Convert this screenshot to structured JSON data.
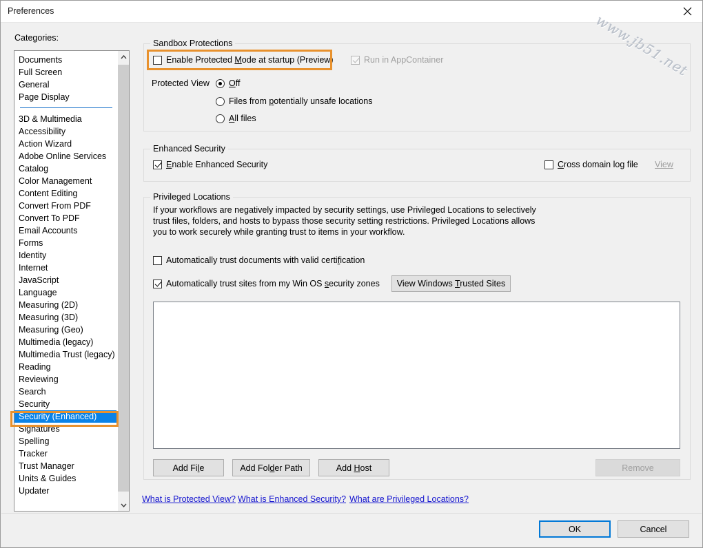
{
  "window": {
    "title": "Preferences",
    "close_icon": "close-icon",
    "watermark": "www.jb51.net"
  },
  "categories": {
    "label": "Categories:",
    "group1": [
      "Documents",
      "Full Screen",
      "General",
      "Page Display"
    ],
    "group2": [
      "3D & Multimedia",
      "Accessibility",
      "Action Wizard",
      "Adobe Online Services",
      "Catalog",
      "Color Management",
      "Content Editing",
      "Convert From PDF",
      "Convert To PDF",
      "Email Accounts",
      "Forms",
      "Identity",
      "Internet",
      "JavaScript",
      "Language",
      "Measuring (2D)",
      "Measuring (3D)",
      "Measuring (Geo)",
      "Multimedia (legacy)",
      "Multimedia Trust (legacy)",
      "Reading",
      "Reviewing",
      "Search",
      "Security",
      "Security (Enhanced)",
      "Signatures",
      "Spelling",
      "Tracker",
      "Trust Manager",
      "Units & Guides",
      "Updater"
    ],
    "selected": "Security (Enhanced)",
    "scroll_up_icon": "chevron-up-icon",
    "scroll_down_icon": "chevron-down-icon"
  },
  "sandbox": {
    "title": "Sandbox Protections",
    "enable_protected_mode": {
      "text_before": "Enable Protected ",
      "accel": "M",
      "text_after": "ode at startup (Preview)",
      "checked": false
    },
    "run_in_appcontainer": {
      "text_before": "Run in AppContainer",
      "checked": true,
      "disabled": true
    },
    "protected_view_label": "Protected View",
    "radios": [
      {
        "before": "",
        "accel": "O",
        "after": "ff",
        "checked": true
      },
      {
        "before": "Files from ",
        "accel": "p",
        "after": "otentially unsafe locations",
        "checked": false
      },
      {
        "before": "",
        "accel": "A",
        "after": "ll files",
        "checked": false
      }
    ]
  },
  "enhanced": {
    "title": "Enhanced Security",
    "enable": {
      "before": "",
      "accel": "E",
      "after": "nable Enhanced Security",
      "checked": true
    },
    "cross_domain": {
      "before": "",
      "accel": "C",
      "after": "ross domain log file",
      "checked": false
    },
    "view_link": "View"
  },
  "privileged": {
    "title": "Privileged Locations",
    "description": "If your workflows are negatively impacted by security settings, use Privileged Locations to selectively trust files, folders, and hosts to bypass those security setting restrictions. Privileged Locations allows you to work securely while granting trust to items in your workflow.",
    "auto_trust_docs": {
      "before": "Automatically trust documents with valid certi",
      "accel": "f",
      "after": "ication",
      "checked": false
    },
    "auto_trust_sites": {
      "before": "Automatically trust sites from my Win OS ",
      "accel": "s",
      "after": "ecurity zones",
      "checked": true
    },
    "view_trusted_sites_btn": {
      "before": "View Windows ",
      "accel": "T",
      "after": "rusted Sites"
    },
    "add_file_btn": {
      "before": "Add Fi",
      "accel": "l",
      "after": "e"
    },
    "add_folder_btn": {
      "before": "Add Fol",
      "accel": "d",
      "after": "er Path"
    },
    "add_host_btn": {
      "before": "Add ",
      "accel": "H",
      "after": "ost"
    },
    "remove_btn": "Remove"
  },
  "help_links": [
    "What is Protected View?",
    "What is Enhanced Security?",
    "What are Privileged Locations?"
  ],
  "footer": {
    "ok": "OK",
    "cancel": "Cancel"
  },
  "colors": {
    "accent": "#0078d7",
    "selection": "#0a82e7",
    "annotation": "#e8912d",
    "link": "#1414cf"
  }
}
